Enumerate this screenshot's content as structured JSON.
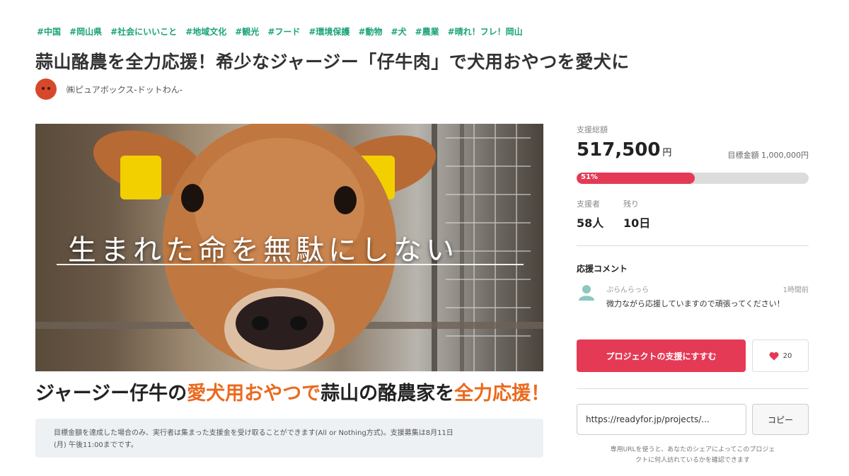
{
  "tags": [
    "#中国",
    "#岡山県",
    "#社会にいいこと",
    "#地域文化",
    "#観光",
    "#フード",
    "#環境保護",
    "#動物",
    "#犬",
    "#農業",
    "#晴れ！フレ！岡山"
  ],
  "project": {
    "title": "蒜山酪農を全力応援！希少なジャージー「仔牛肉」で犬用おやつを愛犬に",
    "owner": "㈱ピュアボックス-ドットわん-"
  },
  "hero": {
    "copy": "生まれた命を無駄にしない"
  },
  "catch": {
    "part1": "ジャージー仔牛の",
    "part2": "愛犬用おやつで",
    "part3": "蒜山の酪農家を",
    "part4": "全力応援！"
  },
  "notice": {
    "line1": "目標金額を達成した場合のみ、実行者は集まった支援金を受け取ることができます(All or Nothing方式)。支援募集は8月11日",
    "line2": "(月) 午後11:00までです。"
  },
  "stats": {
    "raised_label": "支援総額",
    "raised_amount": "517,500",
    "currency": "円",
    "goal_text": "目標金額 1,000,000円",
    "progress_percent": 51,
    "progress_label": "51%",
    "supporters_label": "支援者",
    "supporters_value": "58人",
    "remaining_label": "残り",
    "remaining_value": "10日"
  },
  "comments": {
    "heading": "応援コメント",
    "items": [
      {
        "name": "ぷらんらっら",
        "time": "1時間前",
        "text": "微力ながら応援していますので頑張ってください！"
      }
    ]
  },
  "actions": {
    "support_label": "プロジェクトの支援にすすむ",
    "like_count": "20",
    "share_url": "https://readyfor.jp/projects/...",
    "copy_label": "コピー",
    "share_note_line1": "専用URLを使うと、あなたのシェアによってこのプロジェ",
    "share_note_line2": "クトに何人訪れているかを確認できます"
  },
  "colors": {
    "accent": "#e43a56",
    "tag": "#1aa37a",
    "catch_orange": "#ea6a1e",
    "avatar": "#d7482b"
  },
  "icons": [
    "owner-avatar-icon",
    "user-avatar-icon",
    "heart-icon"
  ]
}
